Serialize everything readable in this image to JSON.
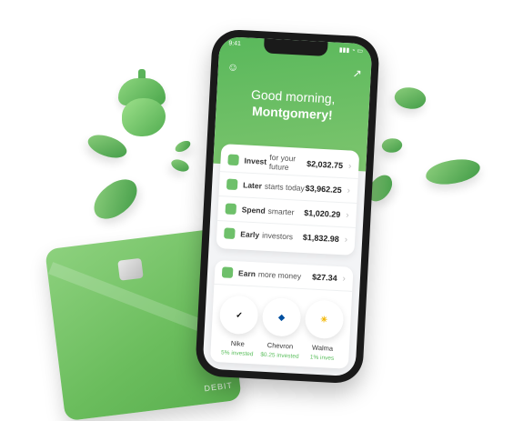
{
  "status": {
    "time": "9:41"
  },
  "greeting": "Good morning,",
  "user_name": "Montgomery!",
  "rows": [
    {
      "title": "Invest",
      "subtitle": "for your future",
      "amount": "$2,032.75"
    },
    {
      "title": "Later",
      "subtitle": "starts today",
      "amount": "$3,962.25"
    },
    {
      "title": "Spend",
      "subtitle": "smarter",
      "amount": "$1,020.29"
    },
    {
      "title": "Early",
      "subtitle": "investors",
      "amount": "$1,832.98"
    }
  ],
  "earn": {
    "title": "Earn",
    "subtitle": "more money",
    "amount": "$27.34"
  },
  "partners": [
    {
      "name": "Nike",
      "label": "5% invested"
    },
    {
      "name": "Chevron",
      "label": "$0.25 invested"
    },
    {
      "name": "Walma",
      "label": "1% inves"
    }
  ],
  "card": {
    "label": "DEBIT"
  },
  "colors": {
    "primary": "#5cb85c",
    "card": "#7cc66c"
  }
}
